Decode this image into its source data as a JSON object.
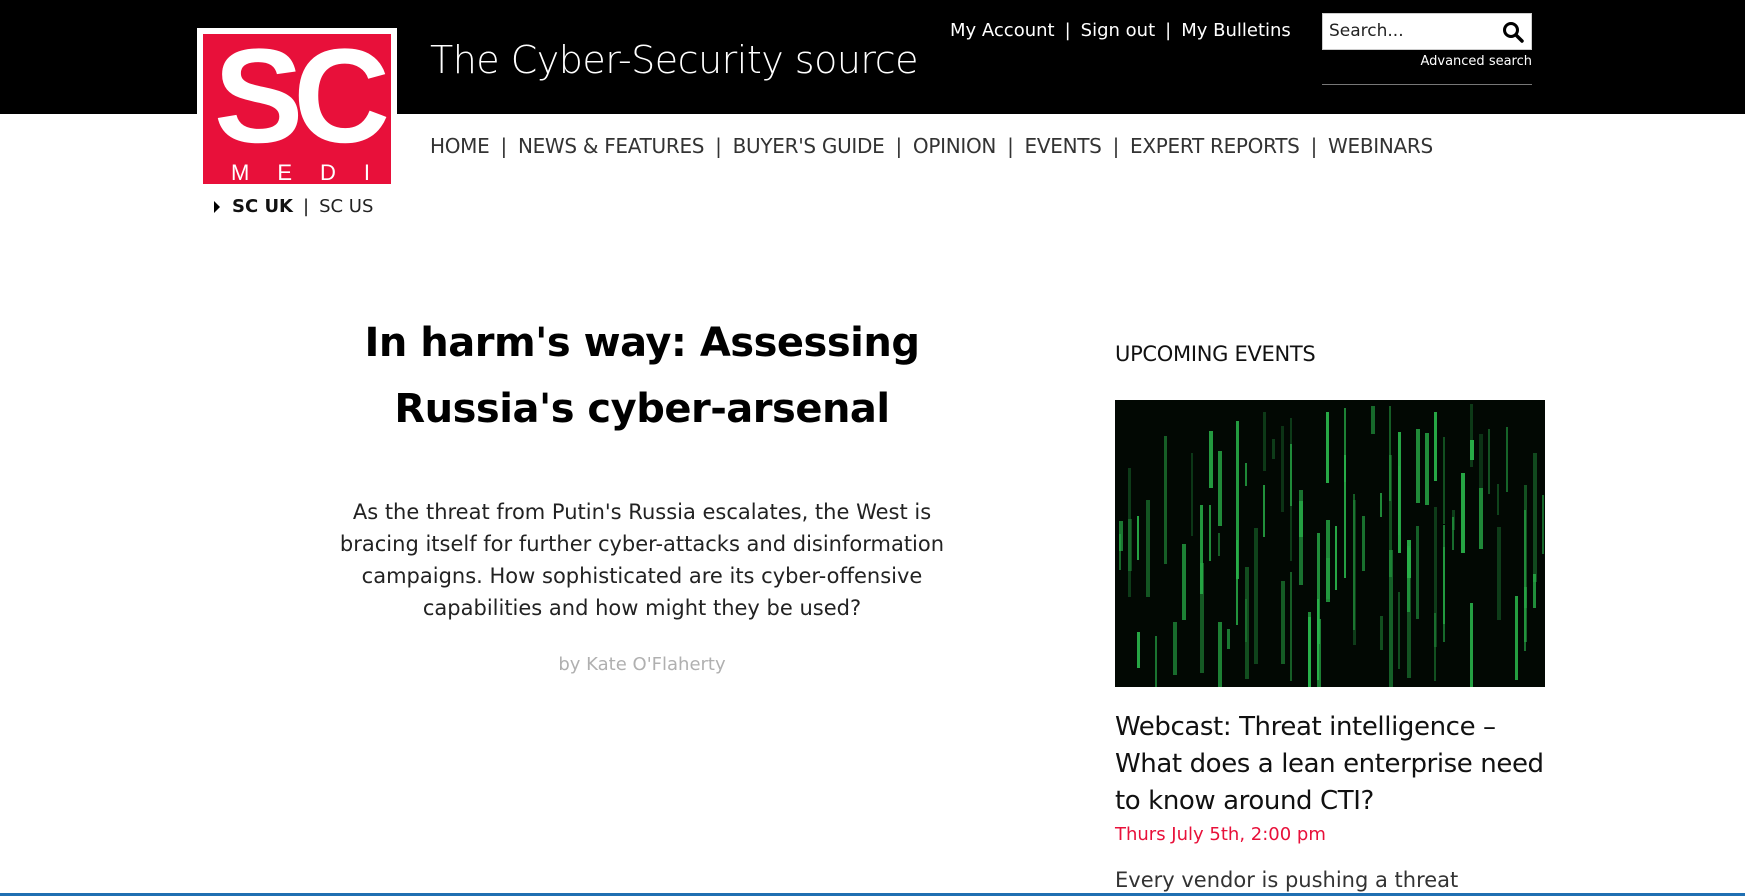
{
  "header": {
    "logo": {
      "letters": "SC",
      "sub": "MEDIA"
    },
    "tagline": "The Cyber-Security source",
    "account_links": [
      "My Account",
      "Sign out",
      "My Bulletins"
    ],
    "search": {
      "placeholder": "Search...",
      "advanced_label": "Advanced search"
    }
  },
  "nav": {
    "items": [
      "HOME",
      "NEWS & FEATURES",
      "BUYER'S GUIDE",
      "OPINION",
      "EVENTS",
      "EXPERT REPORTS",
      "WEBINARS"
    ]
  },
  "region": {
    "active": "SC UK",
    "other": "SC US"
  },
  "article": {
    "title_line1": "In harm's way: Assessing",
    "title_line2": "Russia's cyber-arsenal",
    "standfirst": "As the threat from Putin's Russia escalates, the West is bracing itself for further cyber-attacks and disinformation campaigns. How sophisticated are its cyber-offensive capabilities and how might they be used?",
    "byline": "by Kate O'Flaherty"
  },
  "sidebar": {
    "heading": "UPCOMING EVENTS",
    "event": {
      "title": "Webcast: Threat intelligence – What does a lean enterprise need to know around CTI?",
      "date": "Thurs July 5th, 2:00 pm",
      "description": "Every vendor is pushing a threat"
    }
  },
  "colors": {
    "brand_red": "#e8103a",
    "header_bg": "#000000",
    "matrix_green": "#29b34a"
  }
}
